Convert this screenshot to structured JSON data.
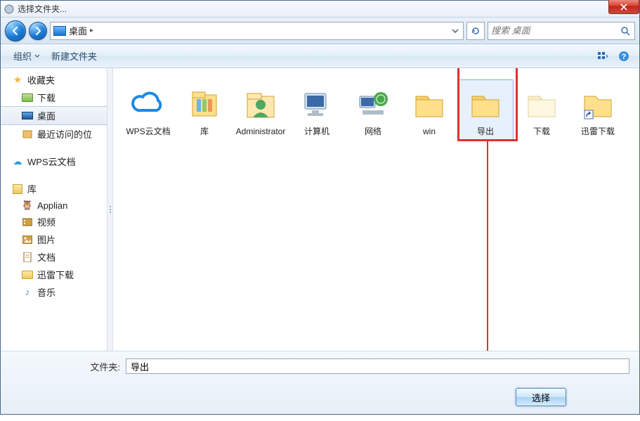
{
  "window": {
    "title": "选择文件夹..."
  },
  "nav": {
    "breadcrumb_location": "桌面",
    "search_placeholder": "搜索 桌面"
  },
  "toolbar": {
    "organize": "组织",
    "new_folder": "新建文件夹"
  },
  "sidebar": {
    "favorites": {
      "label": "收藏夹",
      "items": [
        {
          "label": "下载",
          "icon": "download"
        },
        {
          "label": "桌面",
          "icon": "desktop",
          "selected": true
        },
        {
          "label": "最近访问的位",
          "icon": "recent"
        }
      ]
    },
    "cloud": {
      "label": "WPS云文档"
    },
    "libraries": {
      "label": "库",
      "items": [
        {
          "label": "Applian",
          "icon": "app"
        },
        {
          "label": "视频",
          "icon": "video"
        },
        {
          "label": "图片",
          "icon": "picture"
        },
        {
          "label": "文档",
          "icon": "document"
        },
        {
          "label": "迅雷下载",
          "icon": "xunlei"
        },
        {
          "label": "音乐",
          "icon": "music"
        }
      ]
    }
  },
  "items": [
    {
      "label": "WPS云文档",
      "kind": "cloud"
    },
    {
      "label": "库",
      "kind": "library"
    },
    {
      "label": "Administrator",
      "kind": "user"
    },
    {
      "label": "计算机",
      "kind": "computer"
    },
    {
      "label": "网络",
      "kind": "network"
    },
    {
      "label": "win",
      "kind": "folder"
    },
    {
      "label": "导出",
      "kind": "folder",
      "selected": true
    },
    {
      "label": "下载",
      "kind": "folder-light"
    },
    {
      "label": "迅雷下载",
      "kind": "folder-shortcut"
    }
  ],
  "bottom": {
    "folder_label": "文件夹:",
    "folder_value": "导出",
    "select_btn": "选择"
  }
}
